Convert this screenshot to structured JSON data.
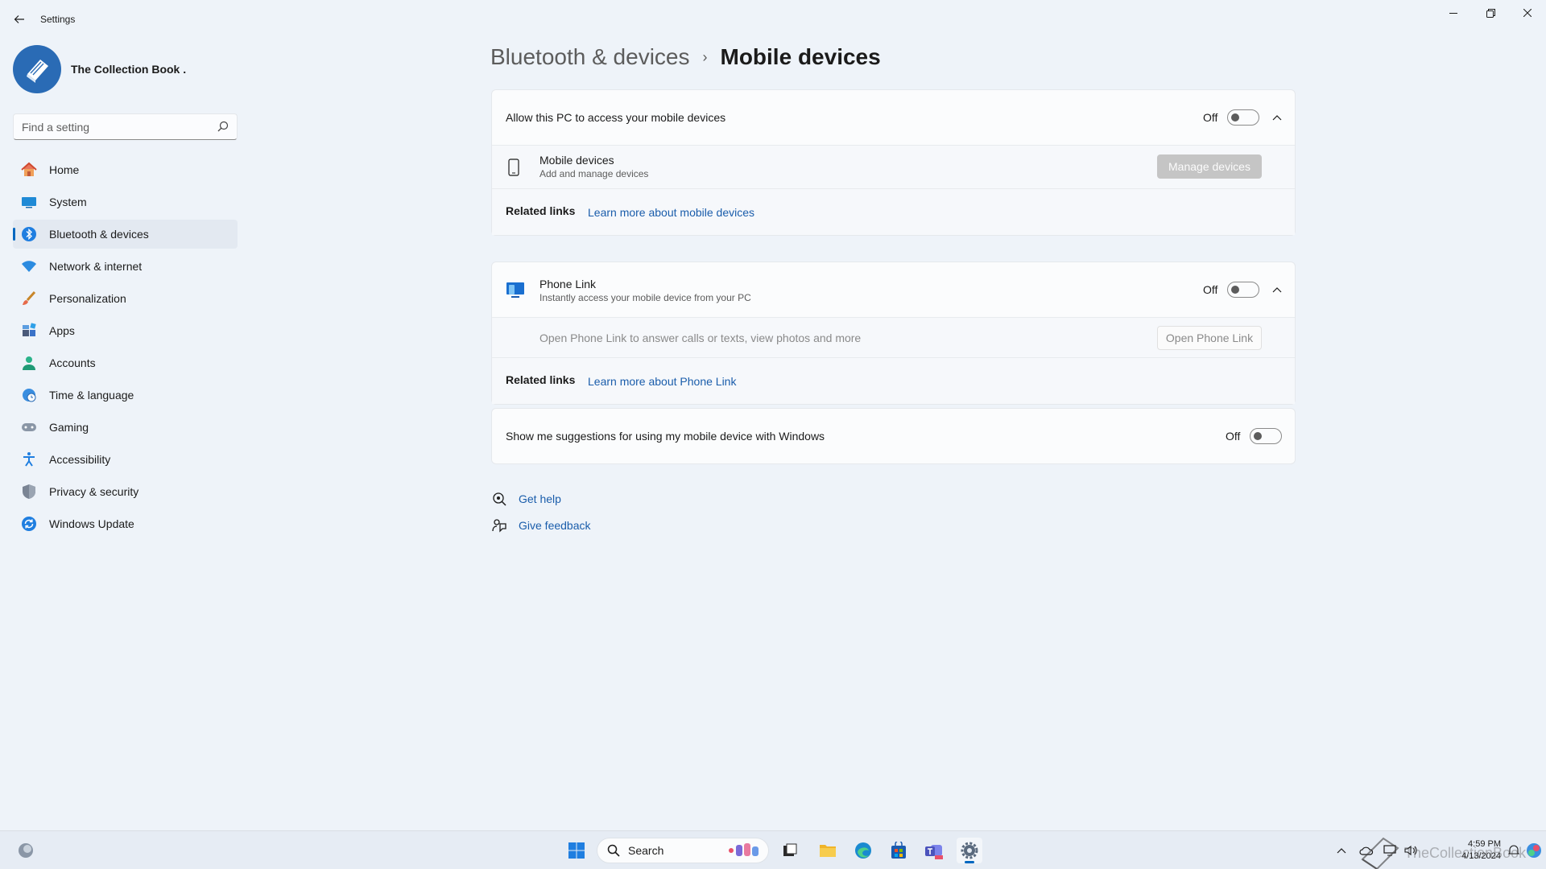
{
  "window": {
    "title": "Settings"
  },
  "profile": {
    "name": "The Collection Book ."
  },
  "search": {
    "placeholder": "Find a setting"
  },
  "nav": [
    {
      "label": "Home",
      "icon": "home-icon"
    },
    {
      "label": "System",
      "icon": "system-icon"
    },
    {
      "label": "Bluetooth & devices",
      "icon": "bluetooth-icon",
      "active": true
    },
    {
      "label": "Network & internet",
      "icon": "wifi-icon"
    },
    {
      "label": "Personalization",
      "icon": "brush-icon"
    },
    {
      "label": "Apps",
      "icon": "apps-icon"
    },
    {
      "label": "Accounts",
      "icon": "person-icon"
    },
    {
      "label": "Time & language",
      "icon": "globe-clock-icon"
    },
    {
      "label": "Gaming",
      "icon": "gamepad-icon"
    },
    {
      "label": "Accessibility",
      "icon": "accessibility-icon"
    },
    {
      "label": "Privacy & security",
      "icon": "shield-icon"
    },
    {
      "label": "Windows Update",
      "icon": "update-icon"
    }
  ],
  "breadcrumb": {
    "parent": "Bluetooth & devices",
    "separator": "›",
    "current": "Mobile devices"
  },
  "card1": {
    "allow_title": "Allow this PC to access your mobile devices",
    "allow_state": "Off",
    "devices_title": "Mobile devices",
    "devices_desc": "Add and manage devices",
    "manage_button": "Manage devices",
    "related_label": "Related links",
    "related_link": "Learn more about mobile devices"
  },
  "card2": {
    "title": "Phone Link",
    "desc": "Instantly access your mobile device from your PC",
    "state": "Off",
    "open_text": "Open Phone Link to answer calls or texts, view photos and more",
    "open_button": "Open Phone Link",
    "related_label": "Related links",
    "related_link": "Learn more about Phone Link"
  },
  "card3": {
    "title": "Show me suggestions for using my mobile device with Windows",
    "state": "Off"
  },
  "help": {
    "get_help": "Get help",
    "feedback": "Give feedback"
  },
  "taskbar": {
    "search_label": "Search",
    "time": "4:59 PM",
    "date": "4/13/2024",
    "watermark": "TheCollectionBook"
  },
  "colors": {
    "accent": "#0067c0",
    "link": "#1a5dab",
    "background": "#eef3f9"
  }
}
